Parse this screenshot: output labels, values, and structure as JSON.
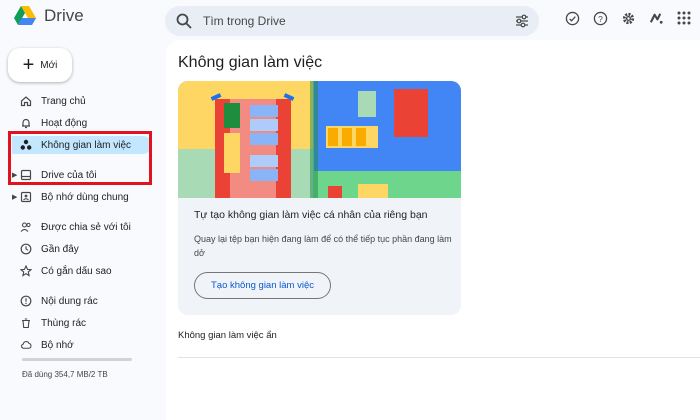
{
  "app": {
    "name": "Drive"
  },
  "search": {
    "placeholder": "Tìm trong Drive"
  },
  "header_icons": [
    "ready-offline-icon",
    "help-icon",
    "settings-icon",
    "gemini-icon",
    "apps-grid-icon"
  ],
  "sidebar": {
    "new_label": "Mới",
    "items": [
      {
        "label": "Trang chủ",
        "icon": "home-icon"
      },
      {
        "label": "Hoạt động",
        "icon": "bell-icon"
      },
      {
        "label": "Không gian làm việc",
        "icon": "workspaces-icon",
        "active": true
      },
      {
        "label": "Drive của tôi",
        "icon": "my-drive-icon"
      },
      {
        "label": "Bộ nhớ dùng chung",
        "icon": "shared-drives-icon"
      },
      {
        "label": "Được chia sẻ với tôi",
        "icon": "people-icon"
      },
      {
        "label": "Gần đây",
        "icon": "clock-icon"
      },
      {
        "label": "Có gắn dấu sao",
        "icon": "star-icon"
      },
      {
        "label": "Nội dung rác",
        "icon": "spam-icon"
      },
      {
        "label": "Thùng rác",
        "icon": "trash-icon"
      },
      {
        "label": "Bộ nhớ",
        "icon": "cloud-icon"
      }
    ],
    "storage_text": "Đã dùng 354,7 MB/2 TB",
    "storage_fraction": 0.0002
  },
  "main": {
    "title": "Không gian làm việc",
    "card": {
      "title": "Tự tạo không gian làm việc cá nhân của riêng bạn",
      "description": "Quay lại tệp bạn hiện đang làm để có thể tiếp tục phần đang làm dở",
      "button": "Tạo không gian làm việc"
    },
    "hidden_label": "Không gian làm việc ẩn"
  },
  "colors": {
    "accent": "#0b57d0",
    "active_bg": "#c2e7ff",
    "highlight": "#e0141e",
    "page_bg": "#f8fafd"
  }
}
